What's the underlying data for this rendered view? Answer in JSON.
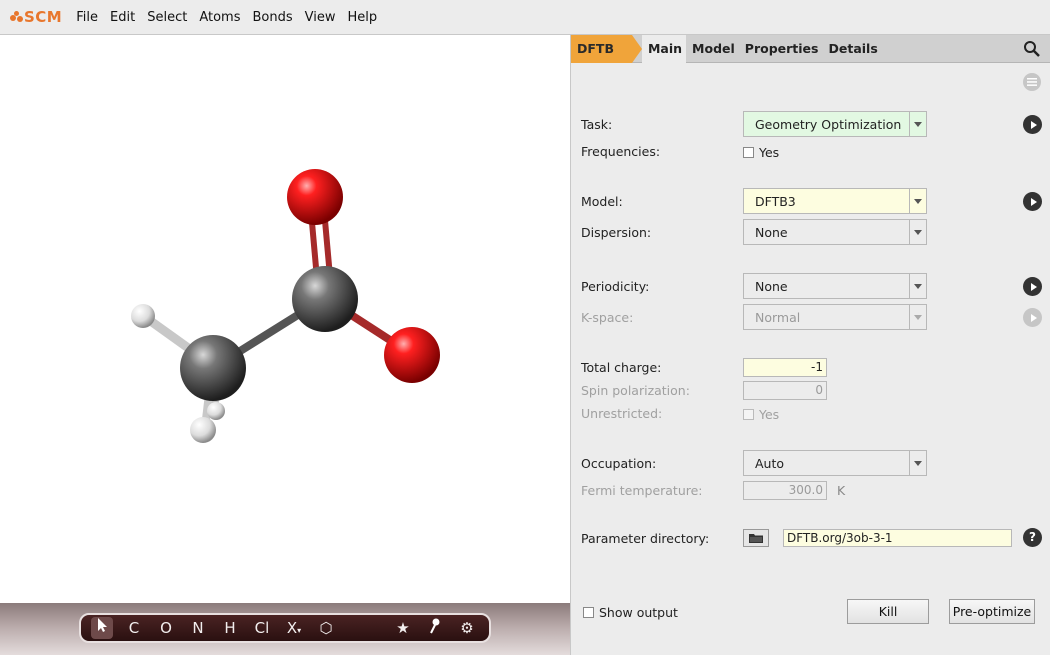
{
  "app": {
    "logo_text": "SCM",
    "brand_color": "#e8762c"
  },
  "menu": [
    "File",
    "Edit",
    "Select",
    "Atoms",
    "Bonds",
    "View",
    "Help"
  ],
  "tabs": {
    "engine": "DFTB",
    "items": [
      "Main",
      "Model",
      "Properties",
      "Details"
    ],
    "active": "Main"
  },
  "form": {
    "task": {
      "label": "Task:",
      "value": "Geometry Optimization"
    },
    "frequencies": {
      "label": "Frequencies:",
      "option": "Yes",
      "checked": false
    },
    "model": {
      "label": "Model:",
      "value": "DFTB3"
    },
    "dispersion": {
      "label": "Dispersion:",
      "value": "None"
    },
    "periodicity": {
      "label": "Periodicity:",
      "value": "None"
    },
    "kspace": {
      "label": "K-space:",
      "value": "Normal"
    },
    "total_charge": {
      "label": "Total charge:",
      "value": "-1"
    },
    "spin_polarization": {
      "label": "Spin polarization:",
      "value": "0"
    },
    "unrestricted": {
      "label": "Unrestricted:",
      "option": "Yes",
      "checked": false
    },
    "occupation": {
      "label": "Occupation:",
      "value": "Auto"
    },
    "fermi_temperature": {
      "label": "Fermi temperature:",
      "value": "300.0",
      "unit": "K"
    },
    "parameter_directory": {
      "label": "Parameter directory:",
      "value": "DFTB.org/3ob-3-1"
    }
  },
  "bottom": {
    "show_output": "Show output",
    "kill": "Kill",
    "preoptimize": "Pre-optimize"
  },
  "toolbar": {
    "tools": [
      "C",
      "O",
      "N",
      "H",
      "Cl",
      "X"
    ]
  },
  "icons": {
    "search": "search-icon",
    "pointer": "pointer-icon",
    "ring": "hexagon-icon",
    "star": "star-icon",
    "pin": "pin-icon",
    "gear": "gear-icon",
    "folder": "folder-icon",
    "help": "?"
  }
}
